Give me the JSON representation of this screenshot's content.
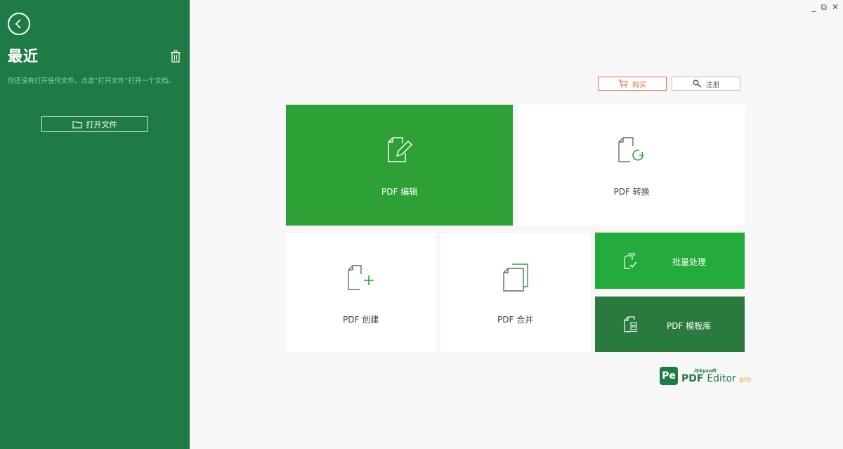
{
  "sidebar": {
    "title": "最近",
    "empty_message": "你还没有打开任何文件。点击“打开文件”打开一个文档。",
    "open_file_label": "打开文件",
    "background": "#1e7b45"
  },
  "window_controls": {
    "minimize": "_",
    "restore": "⧉",
    "close": "✕"
  },
  "top_buttons": {
    "buy_label": "购买",
    "register_label": "注册"
  },
  "tiles": {
    "edit": "PDF 编辑",
    "convert": "PDF 转换",
    "create": "PDF 创建",
    "merge": "PDF 合并",
    "batch": "批量处理",
    "template": "PDF 模板库"
  },
  "logo": {
    "badge": "Pe",
    "brand": "iSkysoft",
    "product": "PDF",
    "editor": "Editor",
    "edition": "pro"
  },
  "colors": {
    "accent": "#2ea136",
    "brand": "#1e7b45",
    "buy": "#e0704a"
  }
}
